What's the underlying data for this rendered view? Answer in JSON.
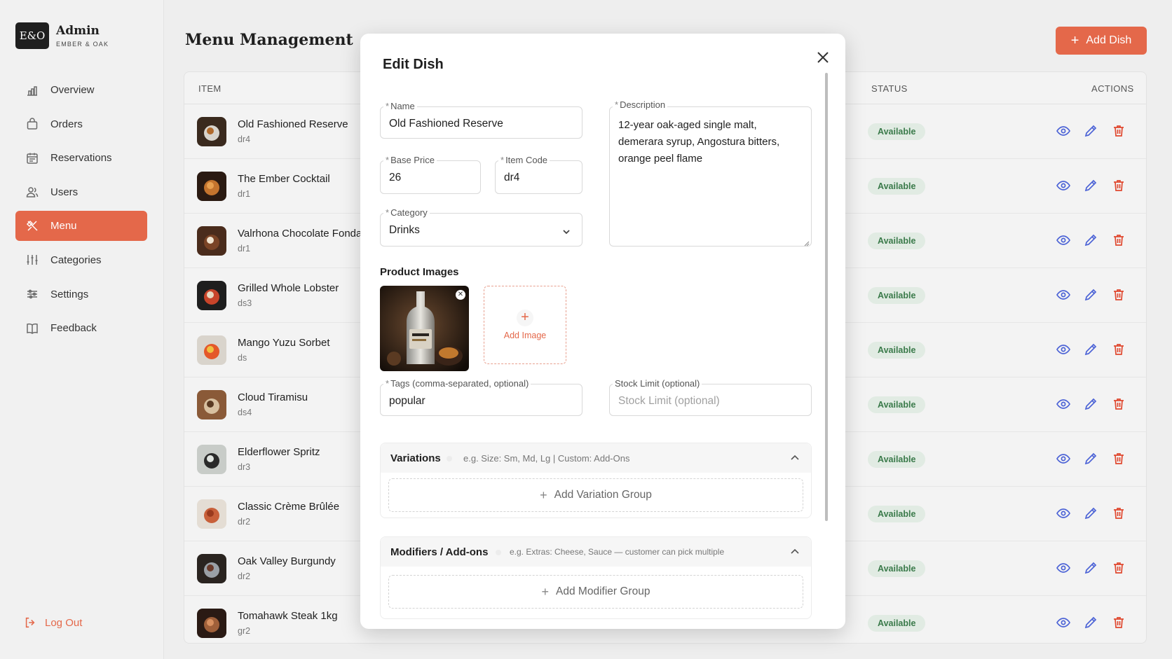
{
  "brand": {
    "logo": "E&O",
    "title": "Admin",
    "subtitle": "EMBER & OAK"
  },
  "nav": [
    {
      "label": "Overview",
      "icon": "chart-icon"
    },
    {
      "label": "Orders",
      "icon": "bag-icon"
    },
    {
      "label": "Reservations",
      "icon": "calendar-icon"
    },
    {
      "label": "Users",
      "icon": "users-icon"
    },
    {
      "label": "Menu",
      "icon": "utensils-icon",
      "active": true
    },
    {
      "label": "Categories",
      "icon": "sliders-icon"
    },
    {
      "label": "Settings",
      "icon": "settings-icon"
    },
    {
      "label": "Feedback",
      "icon": "book-icon"
    }
  ],
  "logout_label": "Log Out",
  "page_title": "Menu Management",
  "add_dish_label": "Add Dish",
  "table": {
    "headers": {
      "item": "ITEM",
      "status": "STATUS",
      "actions": "ACTIONS"
    },
    "rows": [
      {
        "name": "Old Fashioned Reserve",
        "code": "dr4",
        "status": "Available"
      },
      {
        "name": "The Ember Cocktail",
        "code": "dr1",
        "status": "Available"
      },
      {
        "name": "Valrhona Chocolate Fondant",
        "code": "dr1",
        "status": "Available"
      },
      {
        "name": "Grilled Whole Lobster",
        "code": "ds3",
        "status": "Available"
      },
      {
        "name": "Mango Yuzu Sorbet",
        "code": "ds",
        "status": "Available"
      },
      {
        "name": "Cloud Tiramisu",
        "code": "ds4",
        "status": "Available"
      },
      {
        "name": "Elderflower Spritz",
        "code": "dr3",
        "status": "Available"
      },
      {
        "name": "Classic Crème Brûlée",
        "code": "dr2",
        "status": "Available"
      },
      {
        "name": "Oak Valley Burgundy",
        "code": "dr2",
        "status": "Available"
      },
      {
        "name": "Tomahawk Steak 1kg",
        "code": "gr2",
        "status": "Available"
      }
    ]
  },
  "modal": {
    "title": "Edit Dish",
    "name": {
      "label": "Name",
      "value": "Old Fashioned Reserve"
    },
    "description": {
      "label": "Description",
      "value": "12-year oak-aged single malt, demerara syrup, Angostura bitters, orange peel flame"
    },
    "base_price": {
      "label": "Base Price",
      "value": "26"
    },
    "item_code": {
      "label": "Item Code",
      "value": "dr4"
    },
    "category": {
      "label": "Category",
      "value": "Drinks"
    },
    "product_images_label": "Product Images",
    "add_image_label": "Add Image",
    "tags": {
      "label": "Tags (comma-separated, optional)",
      "value": "popular"
    },
    "stock_limit": {
      "label": "Stock Limit (optional)",
      "placeholder": "Stock Limit (optional)"
    },
    "variations": {
      "title": "Variations",
      "hint": "e.g. Size: Sm, Md, Lg | Custom: Add-Ons",
      "add_label": "Add Variation Group"
    },
    "modifiers": {
      "title": "Modifiers / Add-ons",
      "hint": "e.g. Extras: Cheese, Sauce — customer can pick multiple",
      "add_label": "Add Modifier Group"
    }
  },
  "colors": {
    "accent": "#e4684a",
    "status_bg": "#e1ebe3",
    "status_text": "#3a7a4a",
    "action_blue": "#4c63d6",
    "action_red": "#e0482f"
  }
}
